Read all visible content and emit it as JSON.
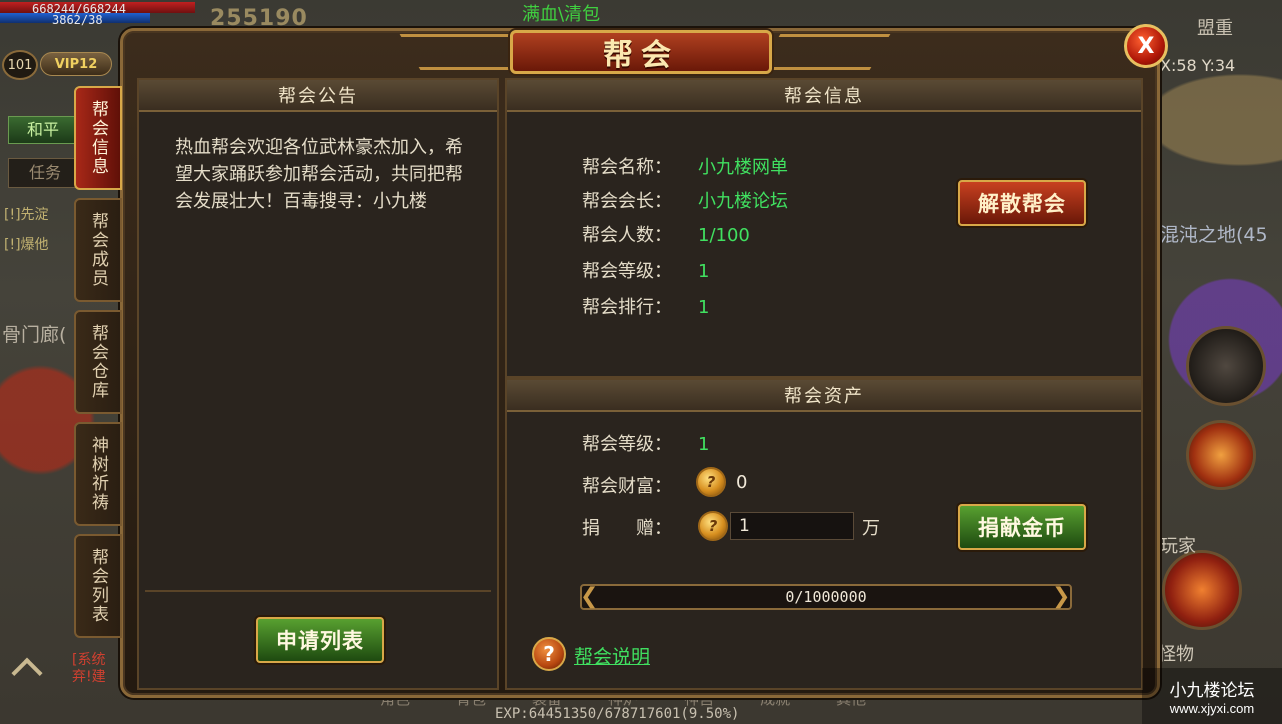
{
  "hud": {
    "hp_text": "668244/668244",
    "mp_text": "3862/38",
    "level": "101",
    "vip": "VIP12",
    "power": "255190",
    "notice": "满血\\清包",
    "pk_mode": "和平",
    "task": "任务",
    "map_name": "盟重",
    "coords": "X:58 Y:34",
    "zone": "混沌之地(45",
    "side_text": "骨门廊(",
    "chat_1": "[!]先淀",
    "chat_2": "[!]爆他",
    "chat_3_line1": "[系统",
    "chat_3_line2": "弃!建",
    "player_label": "玩家",
    "monster_label": "怪物",
    "exp": "EXP:64451350/678717601(9.50%)",
    "bottom_menu": [
      "角色",
      "背包",
      "装备",
      "神炉",
      "神宫",
      "成就",
      "其他"
    ]
  },
  "dialog": {
    "title": "帮会",
    "close_label": "X"
  },
  "tabs": [
    {
      "label": "帮会信息",
      "active": true
    },
    {
      "label": "帮会成员",
      "active": false
    },
    {
      "label": "帮会仓库",
      "active": false
    },
    {
      "label": "神树祈祷",
      "active": false
    },
    {
      "label": "帮会列表",
      "active": false
    }
  ],
  "notice_panel": {
    "header": "帮会公告",
    "text": "热血帮会欢迎各位武林豪杰加入，希望大家踊跃参加帮会活动，共同把帮会发展壮大！百毒搜寻：小九楼",
    "apply_button": "申请列表"
  },
  "info_panel": {
    "header": "帮会信息",
    "rows": [
      {
        "key": "帮会名称：",
        "value": "小九楼网单"
      },
      {
        "key": "帮会会长：",
        "value": "小九楼论坛"
      },
      {
        "key": "帮会人数：",
        "value": "1/100"
      },
      {
        "key": "帮会等级：",
        "value": "1"
      },
      {
        "key": "帮会排行：",
        "value": "1"
      }
    ],
    "disband_button": "解散帮会"
  },
  "asset_panel": {
    "header": "帮会资产",
    "level_key": "帮会等级：",
    "level_value": "1",
    "wealth_key": "帮会财富：",
    "wealth_value": "0",
    "donate_key": "捐　　赠：",
    "donate_value": "1",
    "donate_unit": "万",
    "donate_button": "捐献金币",
    "progress_text": "0/1000000",
    "progress_fraction": 0,
    "help_link": "帮会说明"
  },
  "watermark": {
    "main": "小九楼论坛",
    "url": "www.xjyxi.com"
  },
  "colors": {
    "accent_green": "#40e060",
    "frame_gold": "#d8a848",
    "button_red": "#c84020",
    "button_green": "#58a030"
  }
}
